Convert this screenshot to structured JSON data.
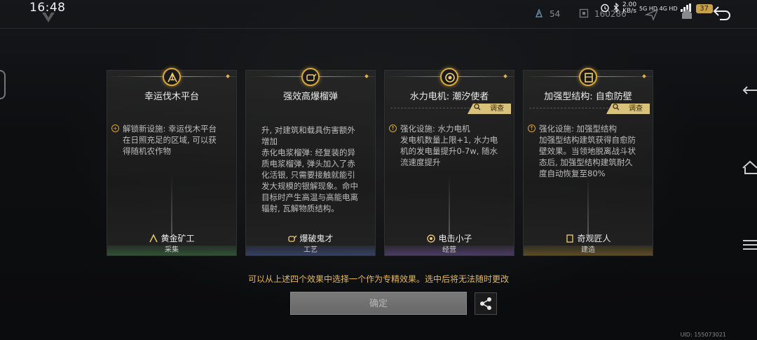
{
  "status_bar": {
    "time": "16:48",
    "net_speed_value": "2.00",
    "net_speed_unit": "KB/s",
    "net_labels": "5G HD 4G HD",
    "battery": "37"
  },
  "resources": [
    {
      "icon": "crystal-icon",
      "value": "54"
    },
    {
      "icon": "box-icon",
      "value": "160286"
    }
  ],
  "cards": [
    {
      "title": "幸运伐木平台",
      "desc_lines": [
        "解锁新设施: 幸运伐木平台",
        "在日照充足的区域, 可以获",
        "得随机农作物"
      ],
      "investigate": "",
      "character": "黄金矿工",
      "category": "采集",
      "icon": "crane-icon",
      "accent": "#3c6e3c"
    },
    {
      "title": "强效高爆榴弹",
      "desc_lines": [
        "升, 对建筑和载具伤害额外",
        "增加",
        "赤化电浆榴弹: 经复装的异",
        "质电浆榴弹, 弹头加入了赤",
        "化活银, 只需要接触就能引",
        "发大规模的银解现象。命中",
        "目标时产生高温与高能电离",
        "辐射, 瓦解物质结构。"
      ],
      "investigate": "",
      "character": "爆破鬼才",
      "category": "工艺",
      "icon": "grenade-icon",
      "accent": "#3c508c"
    },
    {
      "title": "水力电机: 潮汐使者",
      "desc_lines": [
        "强化设施: 水力电机",
        "发电机数量上限+1, 水力电",
        "机的发电量提升0-7w, 随水",
        "流速度提升"
      ],
      "investigate": "调查",
      "character": "电击小子",
      "category": "经营",
      "icon": "coin-icon",
      "accent": "#5a4682"
    },
    {
      "title": "加强型结构: 自愈防壁",
      "desc_lines": [
        "强化设施: 加强型结构",
        "加强型结构建筑获得自愈防",
        "壁效果。当领地脱离战斗状",
        "态后, 加强型结构建筑耐久",
        "度自动恢复至80%"
      ],
      "investigate": "调查",
      "character": "奇观匠人",
      "category": "建造",
      "icon": "shield-wall-icon",
      "accent": "#786428"
    }
  ],
  "hint": "可以从上述四个效果中选择一个作为专精效果。选中后将无法随时更改",
  "confirm_label": "确定",
  "uid": "UID: 155073021"
}
